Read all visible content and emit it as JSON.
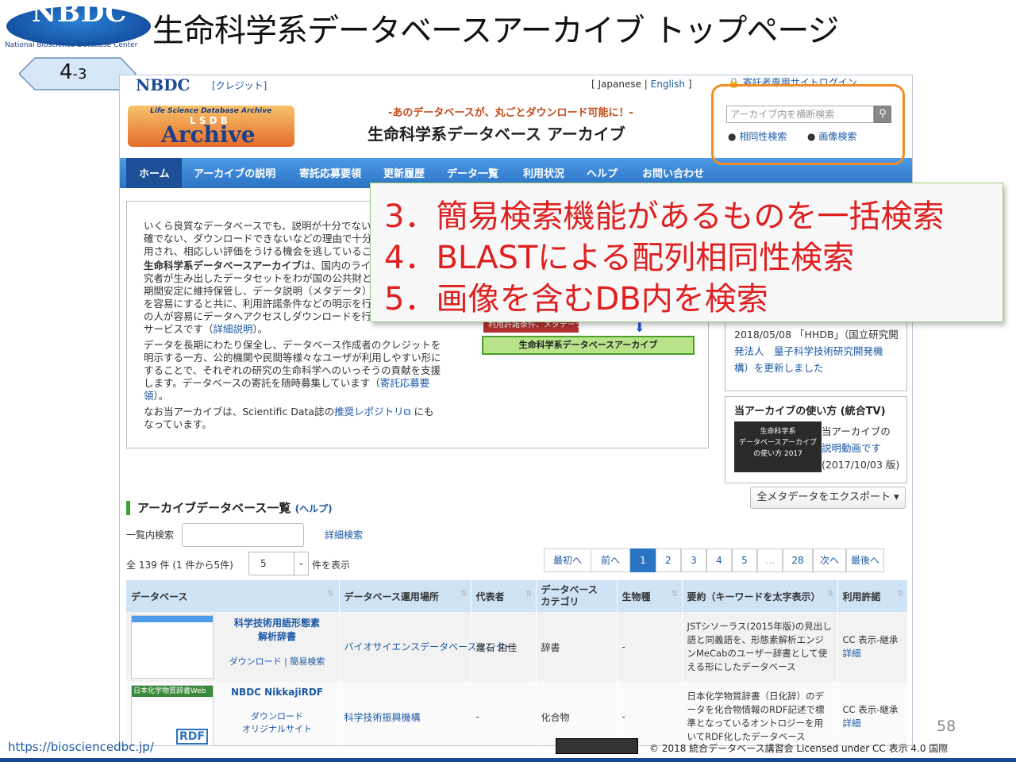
{
  "slide": {
    "logo_text": "NBDC",
    "logo_sub": "National Bioscience Database Center",
    "title": "生命科学系データベースアーカイブ トップページ",
    "badge_main": "4",
    "badge_sub": "-3",
    "page_number": "58",
    "url": "https://biosciencedbc.jp/",
    "credit": "© 2018 統合データベース講習会 Licensed under CC 表示 4.0 国際"
  },
  "site": {
    "header_logo": "NBDC",
    "credit_link": "[クレジット]",
    "lang_prefix": "[ Japanese | ",
    "lang_en": "English",
    "lang_suffix": " ]",
    "login": "寄託者専用サイトログイン",
    "archive_small": "Life Science Database Archive",
    "archive_lsdb": "L S D B",
    "archive_big": "Archive",
    "catch": "-あのデータベースが、丸ごとダウンロード可能に！-",
    "site_title": "生命科学系データベース アーカイブ",
    "search_placeholder": "アーカイブ内を横断検索",
    "link_homology": "相同性検索",
    "link_image": "画像検索"
  },
  "nav": [
    "ホーム",
    "アーカイブの説明",
    "寄託応募要領",
    "更新履歴",
    "データ一覧",
    "利用状況",
    "ヘルプ",
    "お問い合わせ"
  ],
  "intro": {
    "p1": [
      "いくら良質なデータベースでも、説明が十分でない",
      "確でない、ダウンロードできないなどの理由で十分",
      "用され、相応しい評価をうける機会を逃しているこ"
    ],
    "p2_bold": "生命科学系データベースアーカイブ",
    "p2": [
      "は、国内のライ",
      "究者が生み出したデータセットをわが国の公共財と",
      "期間安定に維持保管し、データ説明（メタデータ）",
      "を容易にすると共に、利用許諾条件などの明示を行",
      "の人が容易にデータへアクセスしダウンロードを行",
      "サービスです（"
    ],
    "p2_link": "詳細説明",
    "p2_end": "）。",
    "p3": [
      "データを長期にわたり保全し、データベース作成者のクレジットを",
      "明示する一方、公的機関や民間等様々なユーザが利用しやすい形に",
      "することで、それぞれの研究の生命科学へのいっそうの貢献を支援",
      "します。データベースの寄託を随時募集しています（"
    ],
    "p3_link1": "寄託応募要",
    "p3_link2": "領",
    "p3_end": "）。",
    "p4_a": "なお当アーカイブは、Scientific Data誌の",
    "p4_link": "推奨レポジトリ",
    "p4_b": "にも",
    "p4_c": "なっています。"
  },
  "diagram": {
    "tag": "利用許諾条件、メタデータ",
    "box": "生命科学系データベースアーカイブ"
  },
  "callout": [
    "3．簡易検索機能があるものを一括検索",
    "4．BLASTによる配列相同性検索",
    "5．画像を含むDB内を検索"
  ],
  "news": [
    "2018/05/08 「HHDB」（国立研究開",
    "発法人　量子科学技術研究開発機",
    "構）を更新しました"
  ],
  "tv": {
    "title": "当アーカイブの使い方 (統合TV)",
    "thumb": [
      "生命科学系",
      "データベースアーカイブ",
      "の使い方 2017"
    ],
    "desc": [
      "当アーカイブの",
      "説明動画です",
      "(2017/10/03 版)"
    ]
  },
  "export_button": "全メタデータをエクスポート ▾",
  "list": {
    "heading": "アーカイブデータベース一覧",
    "help": "(ヘルプ)",
    "filter_label": "一覧内検索",
    "detail_search": "詳細検索",
    "count": "全 139 件 (1 件から5件)",
    "per_page": "5",
    "per_page_suffix": "件を表示",
    "pages": [
      "最初へ",
      "前へ",
      "1",
      "2",
      "3",
      "4",
      "5",
      "…",
      "28",
      "次へ",
      "最後へ"
    ]
  },
  "table": {
    "headers": [
      "データベース",
      "データベース運用場所",
      "代表者",
      "データベース\nカテゴリ",
      "生物種",
      "要約（キーワードを太字表示）",
      "利用許諾"
    ],
    "rows": [
      {
        "name": "科学技術用語形態素\n解析辞書",
        "links": "ダウンロード | 簡易検索",
        "site": "バイオサイエンスデータベースセンター",
        "rep": "建石 由佳",
        "cat": "辞書",
        "species": "-",
        "summary": "JSTシソーラス(2015年版)の見出し語と同義語を、形態素解析エンジンMeCabのユーザー辞書として使える形にしたデータベース",
        "license": "CC 表示-継承",
        "detail": "詳細",
        "thumb_label": ""
      },
      {
        "name": "NBDC NikkajiRDF",
        "links": "ダウンロード\nオリジナルサイト",
        "site": "科学技術振興機構",
        "rep": "-",
        "cat": "化合物",
        "species": "-",
        "summary": "日本化学物質辞書（日化辞）のデータを化合物情報のRDF記述で標準となっているオントロジーを用いてRDF化したデータベース",
        "license": "CC 表示-継承",
        "detail": "詳細",
        "thumb_label": "日本化学物質辞書Web",
        "thumb_rdf": "RDF"
      }
    ]
  }
}
